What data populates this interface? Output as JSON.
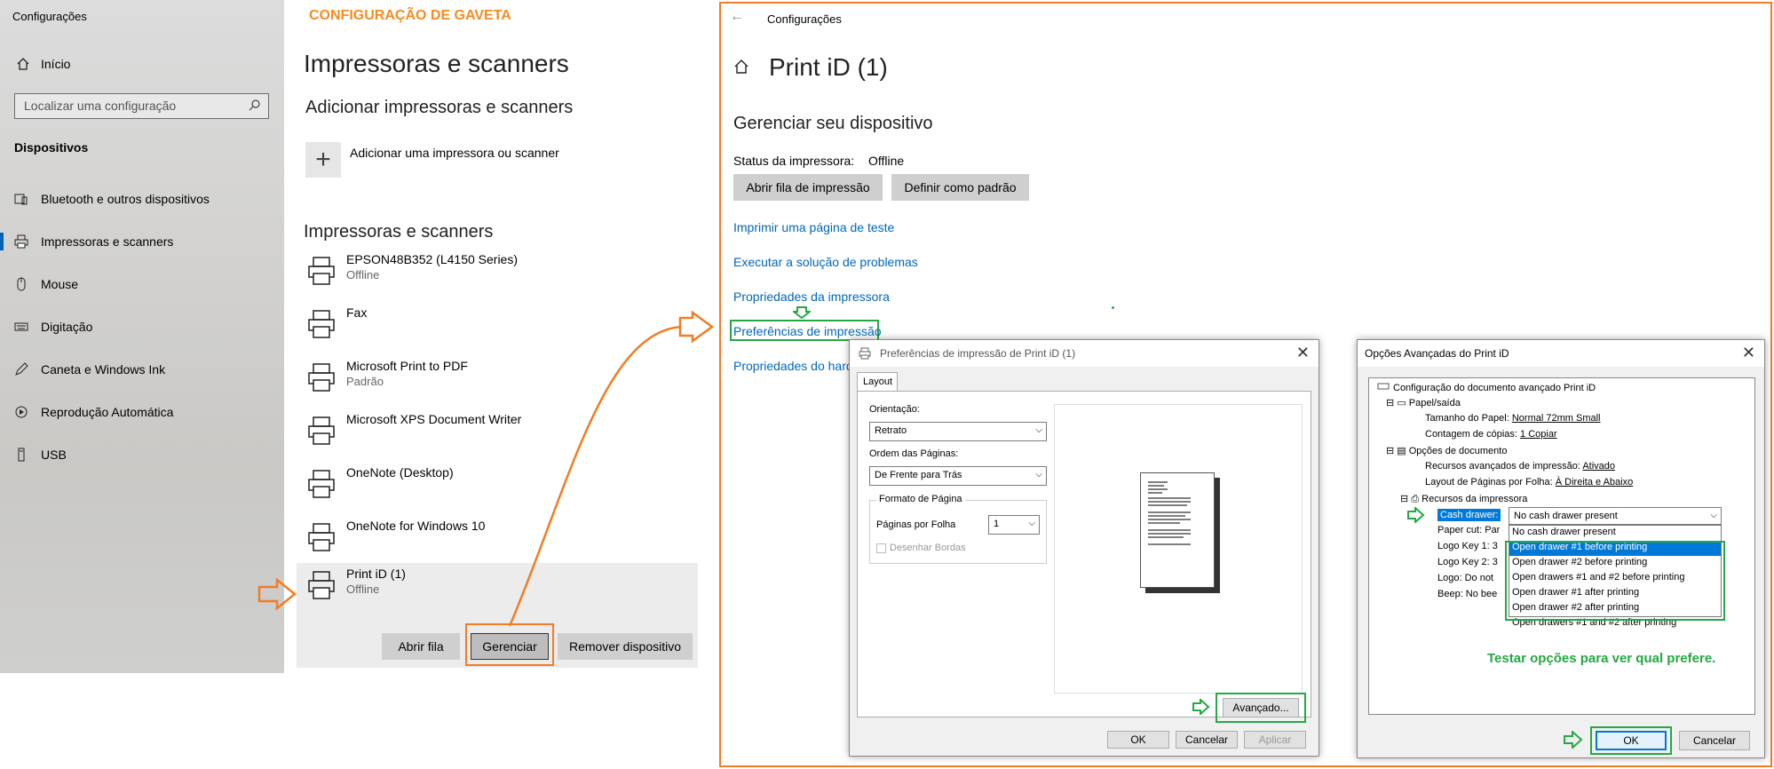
{
  "sidebar": {
    "title": "Configurações",
    "home": "Início",
    "search_placeholder": "Localizar uma configuração",
    "section": "Dispositivos",
    "items": [
      "Bluetooth e outros dispositivos",
      "Impressoras e scanners",
      "Mouse",
      "Digitação",
      "Caneta e Windows Ink",
      "Reprodução Automática",
      "USB"
    ]
  },
  "heading": "CONFIGURAÇÃO DE GAVETA",
  "printers_page": {
    "title": "Impressoras e scanners",
    "add_heading": "Adicionar impressoras e scanners",
    "add_label": "Adicionar uma impressora ou scanner",
    "list_heading": "Impressoras e scanners",
    "printers": [
      {
        "name": "EPSON48B352 (L4150 Series)",
        "status": "Offline"
      },
      {
        "name": "Fax",
        "status": ""
      },
      {
        "name": "Microsoft Print to PDF",
        "status": "Padrão"
      },
      {
        "name": "Microsoft XPS Document Writer",
        "status": ""
      },
      {
        "name": "OneNote (Desktop)",
        "status": ""
      },
      {
        "name": "OneNote for Windows 10",
        "status": ""
      },
      {
        "name": "Print iD (1)",
        "status": "Offline"
      }
    ],
    "buttons": {
      "open_queue": "Abrir fila",
      "manage": "Gerenciar",
      "remove": "Remover dispositivo"
    }
  },
  "device": {
    "window_title": "Configurações",
    "name": "Print iD (1)",
    "manage_heading": "Gerenciar seu dispositivo",
    "status_label": "Status da impressora:",
    "status_value": "Offline",
    "btn_queue": "Abrir fila de impressão",
    "btn_default": "Definir como padrão",
    "links": [
      "Imprimir uma página de teste",
      "Executar a solução de problemas",
      "Propriedades da impressora",
      "Preferências de impressão",
      "Propriedades do hard"
    ]
  },
  "pref_dialog": {
    "title": "Preferências de impressão de Print iD (1)",
    "tab": "Layout",
    "orientation_label": "Orientação:",
    "orientation": "Retrato",
    "order_label": "Ordem das Páginas:",
    "order": "De Frente para Trás",
    "format_label": "Formato de Página",
    "pps_label": "Páginas por Folha",
    "pps": "1",
    "borders": "Desenhar Bordas",
    "advanced": "Avançado...",
    "ok": "OK",
    "cancel": "Cancelar",
    "apply": "Aplicar"
  },
  "adv_dialog": {
    "title": "Opções Avançadas do Print iD",
    "root": "Configuração do documento avançado Print iD",
    "paper": "Papel/saída",
    "paper_size_label": "Tamanho do Papel:",
    "paper_size": "Normal 72mm Small",
    "copies_label": "Contagem de cópias:",
    "copies": "1 Copiar",
    "doc_options": "Opções de documento",
    "adv_features_label": "Recursos avançados de impressão:",
    "adv_features": "Ativado",
    "layout_label": "Layout de Páginas por Folha:",
    "layout": "À Direita e Abaixo",
    "printer_features": "Recursos da impressora",
    "cash_drawer_label": "Cash drawer:",
    "cash_drawer": "No cash drawer present",
    "rows": [
      "Paper cut: Par",
      "Logo Key 1: 3",
      "Logo Key 2: 3",
      "Logo: Do not",
      "Beep: No bee"
    ],
    "options": [
      "No cash drawer present",
      "Open drawer #1 before printing",
      "Open drawer #2 before printing",
      "Open drawers #1 and #2 before printing",
      "Open drawer #1 after printing",
      "Open drawer #2 after printing",
      "Open drawers #1 and #2 after printing"
    ],
    "note": "Testar opções para ver qual prefere.",
    "ok": "OK",
    "cancel": "Cancelar"
  }
}
